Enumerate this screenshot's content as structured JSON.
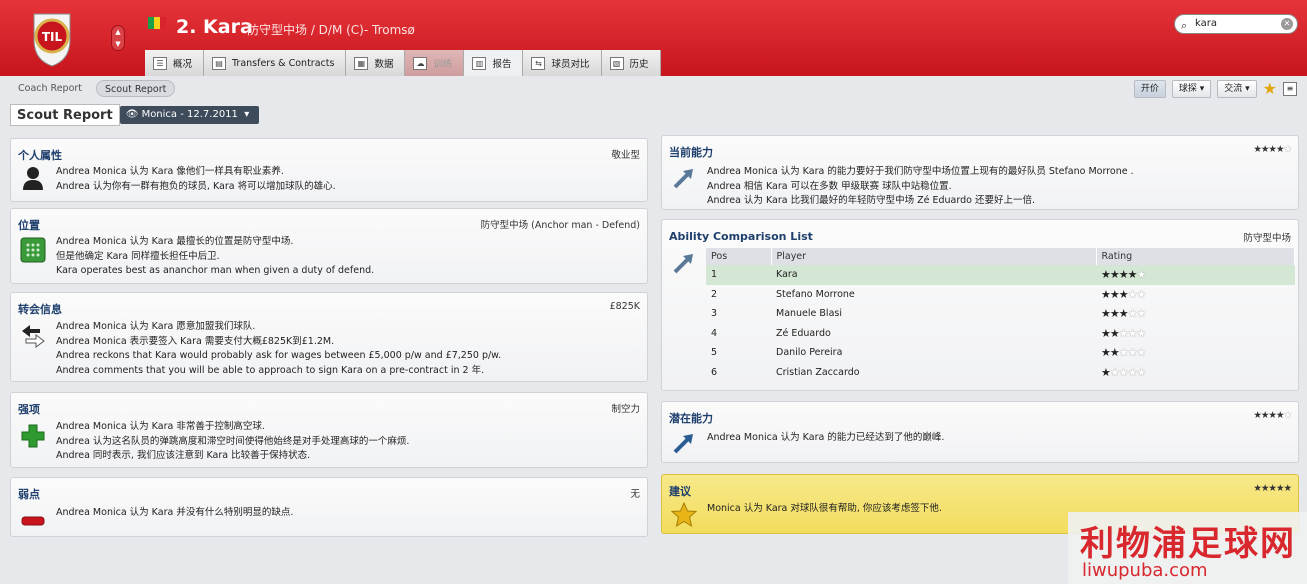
{
  "header": {
    "player_number_name": "2. Kara",
    "player_role": "防守型中场 / D/M (C)- Tromsø",
    "club_badge_text": "TIL",
    "search": {
      "value": "kara"
    },
    "colors": {
      "header_red": "#d71f26",
      "title_blue": "#1f3f6d",
      "star_gold": "#d9a20f",
      "highlight_yellow": "#f2dc5d",
      "table_highlight": "#d4e7d4"
    }
  },
  "tabs": [
    {
      "label": "概况",
      "icon": "profile-icon"
    },
    {
      "label": "Transfers & Contracts",
      "icon": "contract-icon"
    },
    {
      "label": "数据",
      "icon": "stats-icon"
    },
    {
      "label": "训练",
      "icon": "training-icon",
      "disabled": true
    },
    {
      "label": "报告",
      "icon": "report-icon",
      "active": true
    },
    {
      "label": "球员对比",
      "icon": "compare-icon"
    },
    {
      "label": "历史",
      "icon": "history-icon"
    }
  ],
  "subtabs": [
    "Coach Report",
    "Scout Report"
  ],
  "toolbar": {
    "bid": "开价",
    "scout": "球探",
    "exchange": "交流"
  },
  "page": {
    "title": "Scout Report",
    "scout_selector": "Monica - 12.7.2011"
  },
  "left_cards": [
    {
      "title": "个人属性",
      "value": "敬业型",
      "icon": "person-icon",
      "lines": [
        "Andrea Monica 认为 Kara 像他们一样具有职业素养.",
        "Andrea 认为你有一群有抱负的球员, Kara 将可以增加球队的雄心."
      ]
    },
    {
      "title": "位置",
      "value": "防守型中场 (Anchor man - Defend)",
      "icon": "pitch-icon",
      "lines": [
        "Andrea Monica 认为 Kara 最擅长的位置是防守型中场.",
        "但是他确定 Kara 同样擅长担任中后卫.",
        "Kara operates best as ananchor man when given a duty of defend."
      ]
    },
    {
      "title": "转会信息",
      "value": "£825K",
      "icon": "transfer-arrows-icon",
      "lines": [
        "Andrea Monica 认为 Kara 愿意加盟我们球队.",
        "Andrea Monica 表示要签入 Kara 需要支付大概£825K到£1.2M.",
        "Andrea reckons that Kara would probably ask for wages between £5,000 p/w and £7,250 p/w.",
        "Andrea comments that you will be able to approach to sign Kara on a pre-contract in 2 年."
      ]
    },
    {
      "title": "强项",
      "value": "制空力",
      "icon": "plus-icon",
      "lines": [
        "Andrea Monica 认为 Kara 非常善于控制高空球.",
        "Andrea 认为这名队员的弹跳高度和滞空时间使得他始终是对手处理高球的一个麻烦.",
        "Andrea 同时表示, 我们应该注意到 Kara 比较善于保持状态."
      ]
    },
    {
      "title": "弱点",
      "value": "无",
      "icon": "minus-icon",
      "lines": [
        "Andrea Monica 认为 Kara 并没有什么特别明显的缺点."
      ]
    }
  ],
  "current_ability": {
    "title": "当前能力",
    "stars": 4,
    "lines": [
      "Andrea Monica 认为 Kara 的能力要好于我们防守型中场位置上现有的最好队员 Stefano Morrone .",
      "Andrea 相信 Kara 可以在多数 甲级联赛 球队中站稳位置.",
      "Andrea 认为 Kara 比我们最好的年轻防守型中场 Zé Eduardo 还要好上一倍."
    ]
  },
  "ability_list": {
    "title": "Ability Comparison List",
    "position": "防守型中场",
    "columns": [
      "Pos",
      "Player",
      "Rating"
    ],
    "rows": [
      {
        "pos": "1",
        "player": "Kara",
        "stars": 4
      },
      {
        "pos": "2",
        "player": "Stefano Morrone",
        "stars": 3
      },
      {
        "pos": "3",
        "player": "Manuele Blasi",
        "stars": 3
      },
      {
        "pos": "4",
        "player": "Zé Eduardo",
        "stars": 2
      },
      {
        "pos": "5",
        "player": "Danilo Pereira",
        "stars": 2
      },
      {
        "pos": "6",
        "player": "Cristian Zaccardo",
        "stars": 1
      }
    ]
  },
  "potential": {
    "title": "潜在能力",
    "stars": 4,
    "lines": [
      "Andrea Monica 认为 Kara 的能力已经达到了他的巅峰."
    ]
  },
  "recommendation": {
    "title": "建议",
    "stars": 5,
    "lines": [
      "Monica 认为 Kara 对球队很有帮助, 你应该考虑签下他."
    ]
  },
  "watermark": {
    "cn": "利物浦足球网",
    "en": "liwupuba.com"
  }
}
